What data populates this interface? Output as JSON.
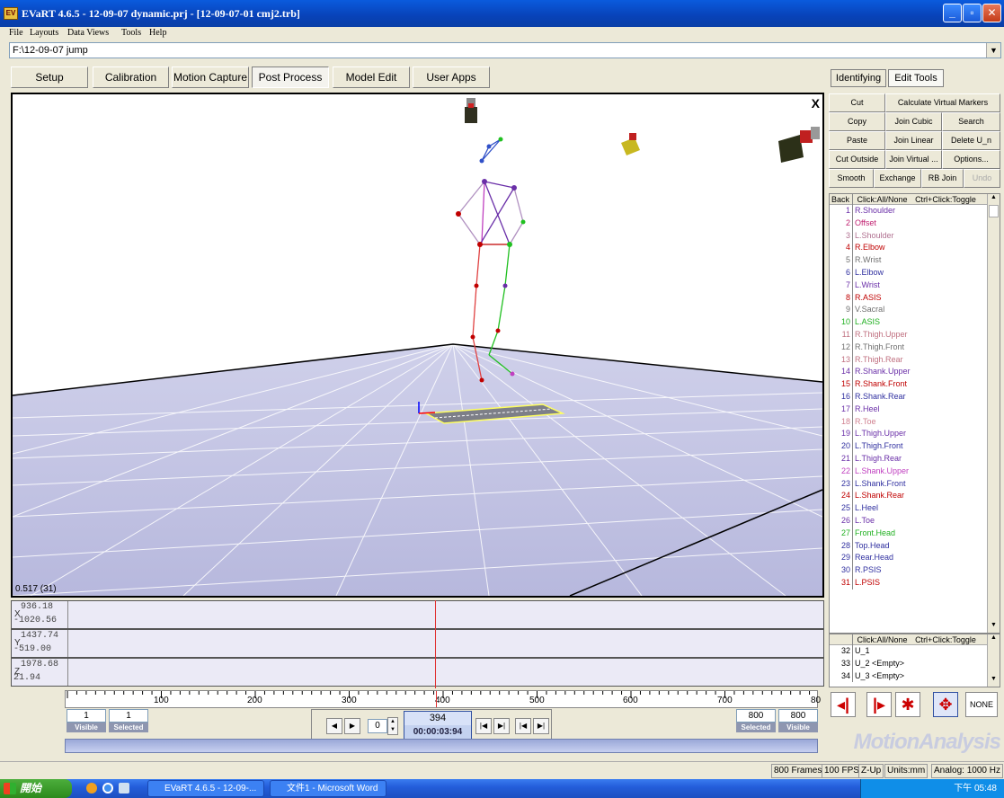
{
  "window": {
    "title": "EVaRT 4.6.5 - 12-09-07 dynamic.prj - [12-09-07-01 cmj2.trb]",
    "controls": [
      "minimize",
      "maximize",
      "close"
    ]
  },
  "menu": [
    "File",
    "Layouts",
    "Data Views",
    "Tools",
    "Help"
  ],
  "path": "F:\\12-09-07 jump",
  "main_tabs": [
    {
      "label": "Setup"
    },
    {
      "label": "Calibration"
    },
    {
      "label": "Motion Capture"
    },
    {
      "label": "Post Process",
      "active": true
    },
    {
      "label": "Model Edit"
    },
    {
      "label": "User Apps"
    }
  ],
  "view": {
    "frame_info": "0.517 (31)",
    "close": "X"
  },
  "graphs": [
    {
      "axis": "X",
      "max": "936.18",
      "min": "-1020.56"
    },
    {
      "axis": "Y",
      "max": "1437.74",
      "min": "-519.00"
    },
    {
      "axis": "Z",
      "max": "1978.68",
      "min": "21.94"
    }
  ],
  "ruler_ticks": [
    "100",
    "200",
    "300",
    "400",
    "500",
    "600",
    "700",
    "80"
  ],
  "range_left": {
    "visible": "1",
    "selected": "1",
    "visible_label": "Visible",
    "selected_label": "Selected"
  },
  "range_right": {
    "selected": "800",
    "visible": "800",
    "selected_label": "Selected",
    "visible_label": "Visible"
  },
  "playback": {
    "step": "0",
    "frame": "394",
    "time": "00:00:03:94"
  },
  "right_tabs": [
    {
      "label": "Identifying"
    },
    {
      "label": "Edit Tools",
      "active": true
    }
  ],
  "tools": [
    [
      "Cut",
      "Calculate Virtual Markers"
    ],
    [
      "Copy",
      "Join Cubic",
      "Search"
    ],
    [
      "Paste",
      "Join Linear",
      "Delete U_n"
    ],
    [
      "Cut Outside",
      "Join Virtual ...",
      "Options..."
    ],
    [
      "Smooth",
      "Exchange",
      "RB Join",
      "Undo"
    ]
  ],
  "marker_list_header": {
    "back": "Back",
    "click_all": "Click:All/None",
    "toggle": "Ctrl+Click:Toggle"
  },
  "markers": [
    {
      "n": "1",
      "name": "R.Shoulder",
      "color": "#6a2fa8"
    },
    {
      "n": "2",
      "name": "Offset",
      "color": "#c02070"
    },
    {
      "n": "3",
      "name": "L.Shoulder",
      "color": "#b07090"
    },
    {
      "n": "4",
      "name": "R.Elbow",
      "color": "#c00000"
    },
    {
      "n": "5",
      "name": "R.Wrist",
      "color": "#707070"
    },
    {
      "n": "6",
      "name": "L.Elbow",
      "color": "#3030a0"
    },
    {
      "n": "7",
      "name": "L.Wrist",
      "color": "#6a2fa8"
    },
    {
      "n": "8",
      "name": "R.ASIS",
      "color": "#c00000"
    },
    {
      "n": "9",
      "name": "V.Sacral",
      "color": "#707070"
    },
    {
      "n": "10",
      "name": "L.ASIS",
      "color": "#20b020"
    },
    {
      "n": "11",
      "name": "R.Thigh.Upper",
      "color": "#c07080"
    },
    {
      "n": "12",
      "name": "R.Thigh.Front",
      "color": "#707070"
    },
    {
      "n": "13",
      "name": "R.Thigh.Rear",
      "color": "#c07080"
    },
    {
      "n": "14",
      "name": "R.Shank.Upper",
      "color": "#6a2fa8"
    },
    {
      "n": "15",
      "name": "R.Shank.Front",
      "color": "#c00000"
    },
    {
      "n": "16",
      "name": "R.Shank.Rear",
      "color": "#3030a0"
    },
    {
      "n": "17",
      "name": "R.Heel",
      "color": "#6a2fa8"
    },
    {
      "n": "18",
      "name": "R.Toe",
      "color": "#d08090"
    },
    {
      "n": "19",
      "name": "L.Thigh.Upper",
      "color": "#6a2fa8"
    },
    {
      "n": "20",
      "name": "L.Thigh.Front",
      "color": "#3030a0"
    },
    {
      "n": "21",
      "name": "L.Thigh.Rear",
      "color": "#6a2fa8"
    },
    {
      "n": "22",
      "name": "L.Shank.Upper",
      "color": "#c040c0"
    },
    {
      "n": "23",
      "name": "L.Shank.Front",
      "color": "#3030a0"
    },
    {
      "n": "24",
      "name": "L.Shank.Rear",
      "color": "#c00000"
    },
    {
      "n": "25",
      "name": "L.Heel",
      "color": "#3030a0"
    },
    {
      "n": "26",
      "name": "L.Toe",
      "color": "#6a2fa8"
    },
    {
      "n": "27",
      "name": "Front.Head",
      "color": "#20b020"
    },
    {
      "n": "28",
      "name": "Top.Head",
      "color": "#3030a0"
    },
    {
      "n": "29",
      "name": "Rear.Head",
      "color": "#3030a0"
    },
    {
      "n": "30",
      "name": "R.PSIS",
      "color": "#3030a0"
    },
    {
      "n": "31",
      "name": "L.PSIS",
      "color": "#c00000"
    }
  ],
  "unnamed_header": {
    "click_all": "Click:All/None",
    "toggle": "Ctrl+Click:Toggle"
  },
  "unnamed": [
    {
      "n": "32",
      "name": "U_1"
    },
    {
      "n": "33",
      "name": "U_2 <Empty>"
    },
    {
      "n": "34",
      "name": "U_3 <Empty>"
    }
  ],
  "view_buttons": {
    "none": "NONE"
  },
  "logo": "MotionAnalysis",
  "status": [
    "800 Frames",
    "100 FPS",
    "Z-Up",
    "Units:mm",
    "Analog: 1000 Hz"
  ],
  "taskbar": {
    "start": "開始",
    "items": [
      "EVaRT 4.6.5 - 12-09-...",
      "文件1 - Microsoft Word"
    ],
    "clock": "下午 05:48"
  }
}
